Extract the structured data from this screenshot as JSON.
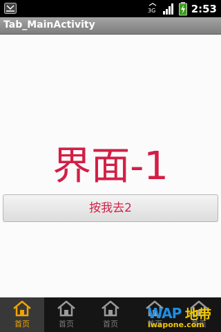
{
  "status_bar": {
    "time": "2:53",
    "network_label": "3G",
    "left_icon": "missed-call-icon",
    "icons": [
      "sync-icon",
      "signal-icon",
      "battery-charging-icon"
    ]
  },
  "title_bar": {
    "title": "Tab_MainActivity"
  },
  "main": {
    "headline": "界面-1",
    "button_label": "按我去2"
  },
  "tab_bar": {
    "tabs": [
      {
        "label": "首页",
        "icon": "home-icon",
        "active": true
      },
      {
        "label": "首页",
        "icon": "home-icon",
        "active": false
      },
      {
        "label": "首页",
        "icon": "home-icon",
        "active": false
      },
      {
        "label": "首页",
        "icon": "home-icon",
        "active": false
      },
      {
        "label": "首页",
        "icon": "home-icon",
        "active": false
      }
    ]
  },
  "watermark": {
    "brand": "WAP",
    "cn": "地带",
    "url": "iwapone.com"
  },
  "colors": {
    "accent": "#d31f45",
    "active_tab": "#f0a400",
    "inactive_tab": "#7e7e7e",
    "title_bar": "#8f8f8f",
    "tab_bar_bg": "#151515"
  }
}
